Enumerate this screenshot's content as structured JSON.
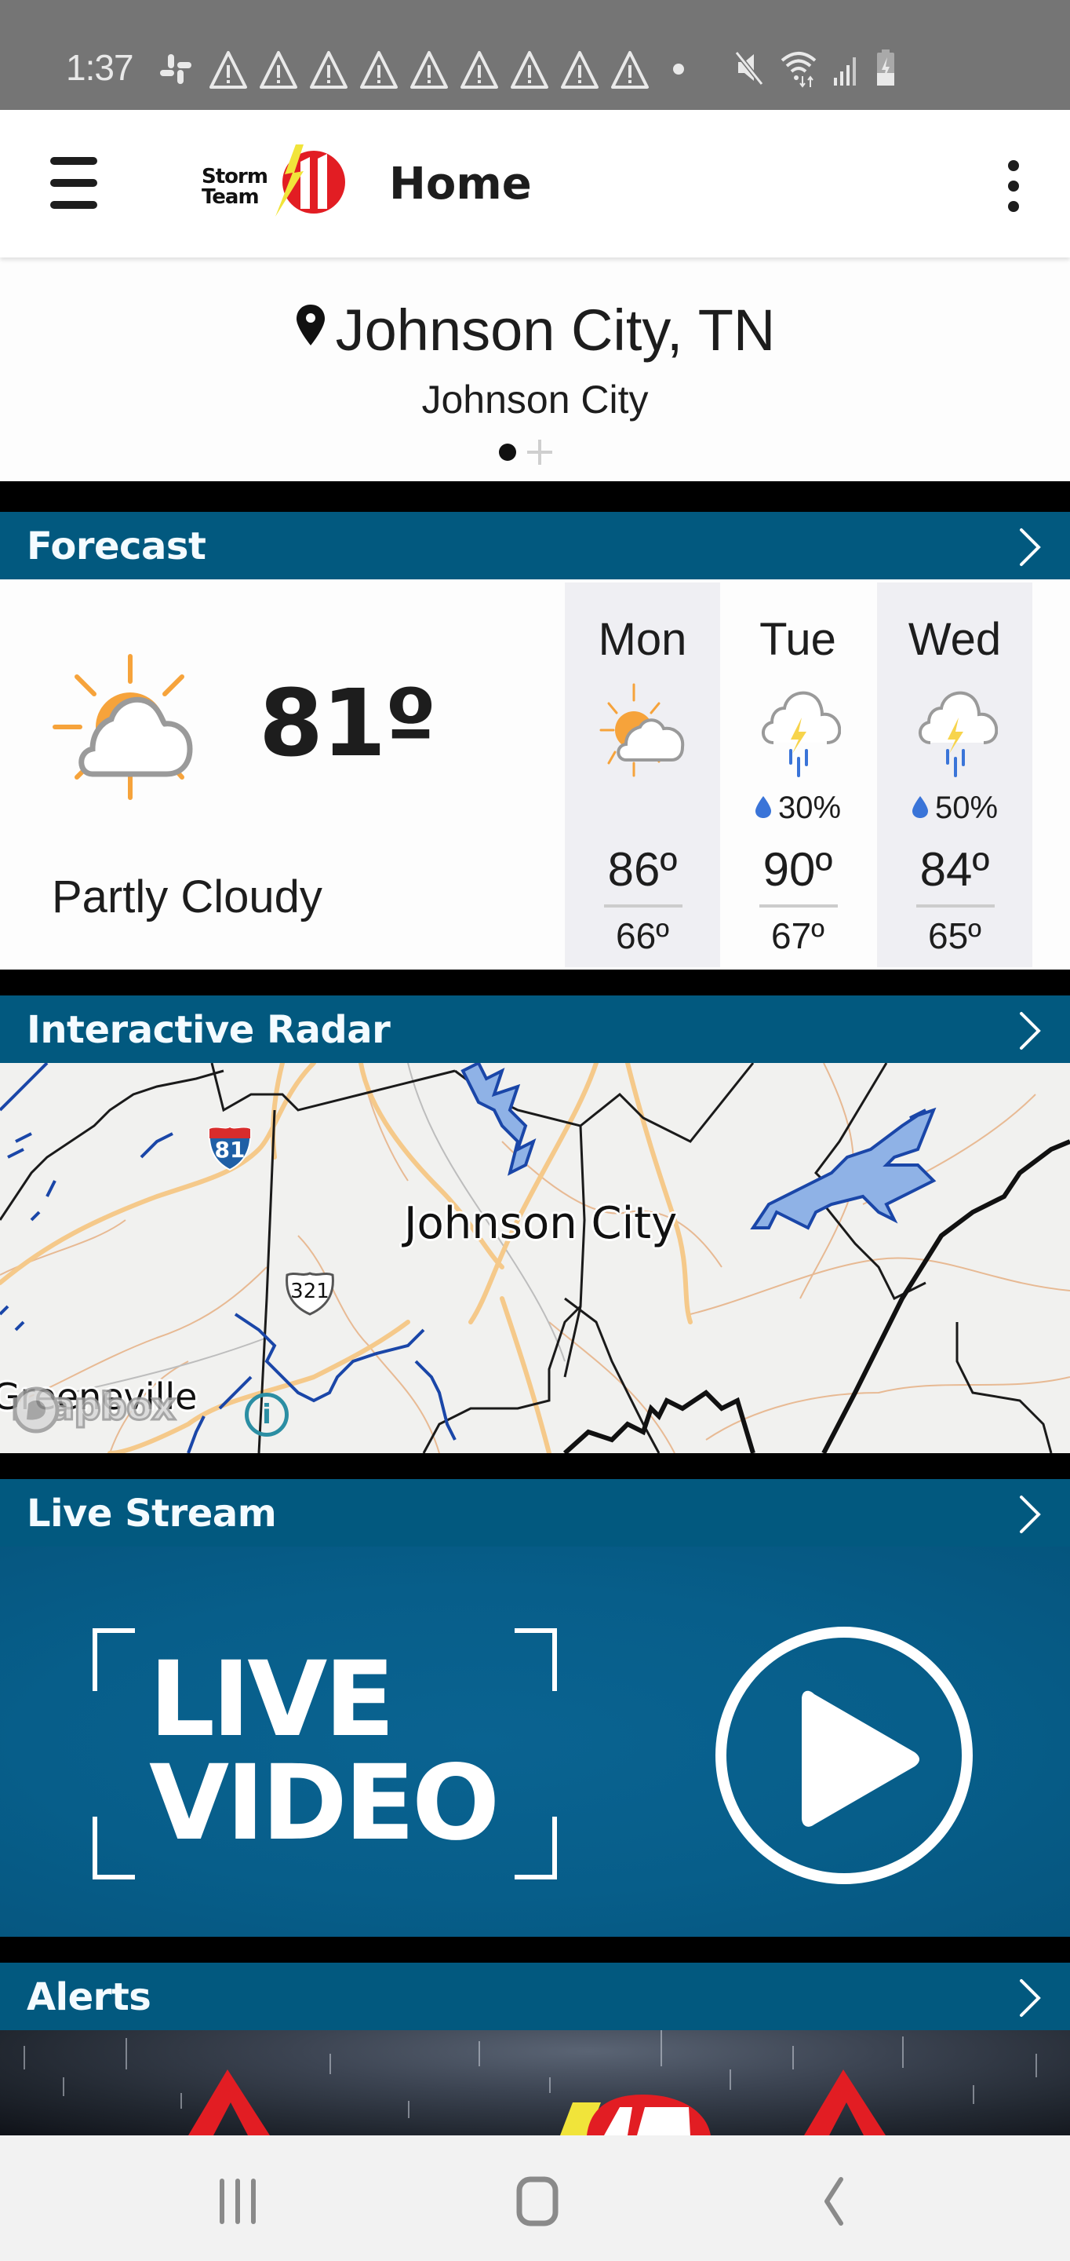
{
  "status_bar": {
    "time": "1:37",
    "left_icons": [
      "slack-icon",
      "warning-icon",
      "warning-icon",
      "warning-icon",
      "warning-icon",
      "warning-icon",
      "warning-icon",
      "warning-icon",
      "warning-icon",
      "warning-icon",
      "notification-dot"
    ],
    "right_icons": [
      "mute-icon",
      "wifi-icon",
      "signal-icon",
      "battery-charging-icon"
    ]
  },
  "app_bar": {
    "menu_icon": "hamburger-menu-icon",
    "logo_text_line1": "Storm",
    "logo_text_line2": "Team",
    "logo_number": "11",
    "title": "Home",
    "overflow_icon": "more-vertical-icon"
  },
  "location": {
    "pin_icon": "location-pin-icon",
    "title": "Johnson City, TN",
    "subtitle": "Johnson City",
    "pager": {
      "pages": 1,
      "current": 1,
      "add_icon": "plus-icon"
    }
  },
  "sections": {
    "forecast": {
      "title": "Forecast",
      "chevron": "chevron-right-icon"
    },
    "radar": {
      "title": "Interactive Radar",
      "chevron": "chevron-right-icon"
    },
    "live": {
      "title": "Live Stream",
      "chevron": "chevron-right-icon"
    },
    "alerts": {
      "title": "Alerts",
      "chevron": "chevron-right-icon"
    }
  },
  "forecast": {
    "current": {
      "icon": "partly-cloudy-icon",
      "temp": "81º",
      "condition": "Partly Cloudy"
    },
    "days": [
      {
        "day": "Mon",
        "icon": "partly-cloudy-icon",
        "precip": "",
        "high": "86º",
        "low": "66º"
      },
      {
        "day": "Tue",
        "icon": "thunderstorm-icon",
        "precip": "30%",
        "high": "90º",
        "low": "67º"
      },
      {
        "day": "Wed",
        "icon": "thunderstorm-icon",
        "precip": "50%",
        "high": "84º",
        "low": "65º"
      }
    ]
  },
  "radar": {
    "labels": {
      "city": "Johnson City",
      "town": "Greeneville"
    },
    "shields": {
      "interstate": "81",
      "us_route": "321"
    },
    "attribution": "mapbox",
    "info_icon": "i"
  },
  "live_stream": {
    "line1": "LIVE",
    "line2": "VIDEO",
    "play_icon": "play-circle-icon"
  },
  "alerts": {
    "image": "storm-alert-banner"
  },
  "nav_bar": {
    "recents": "recents-icon",
    "home": "home-icon",
    "back": "back-icon"
  },
  "colors": {
    "section_header": "#02597f",
    "status_bar": "#757575",
    "accent_red": "#e21d23",
    "sun_orange": "#f6a33b",
    "bolt_yellow": "#f7d44c",
    "rain_blue": "#3a74d8"
  }
}
